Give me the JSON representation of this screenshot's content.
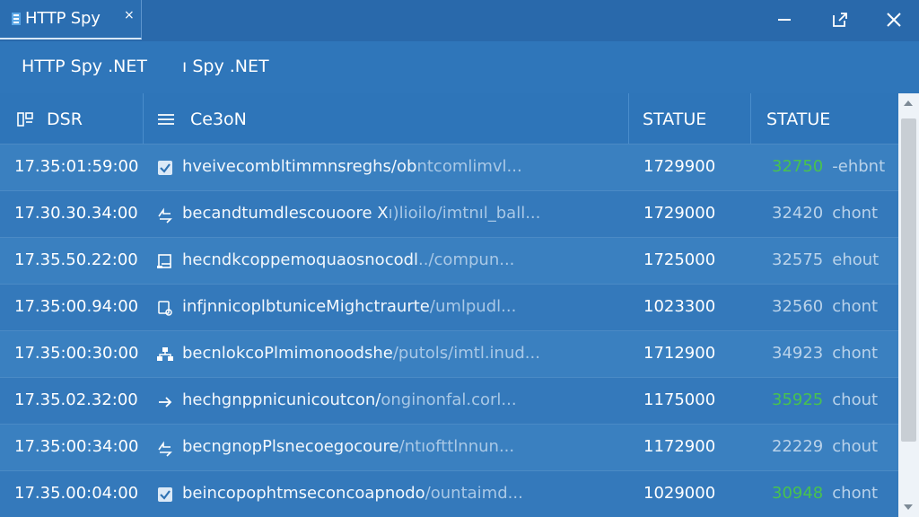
{
  "window": {
    "tab_title": "HTTP Spy",
    "tab_close": "×",
    "controls": [
      "minimize-icon",
      "popout-icon",
      "close-icon"
    ]
  },
  "header": {
    "title": "HTTP Spy .NET",
    "subtitle": "ı Spy .NET"
  },
  "table": {
    "columns": [
      "DSR",
      "Ce3oN",
      "STATUE",
      "STATUE"
    ],
    "rows": [
      {
        "time": "17.35:01:59:00",
        "icon": "checkbox-icon",
        "url": "hveivecombltimmnsreghs/ob",
        "url_faded": "ntcomlimvl...",
        "size": "1729900",
        "status": "32750",
        "status_style": "green",
        "label": "-ehbnt"
      },
      {
        "time": "17.30.30.34:00",
        "icon": "request-icon",
        "url": "becandtumdlescouoore X",
        "url_faded": "ı)lioilo/imtnıl_ball...",
        "size": "1729000",
        "status": "32420",
        "status_style": "gray",
        "label": "chont"
      },
      {
        "time": "17.35.50.22:00",
        "icon": "document-icon",
        "url": "hecndkcoppemoquaosnocodl",
        "url_faded": "../compun...",
        "size": "1725000",
        "status": "32575",
        "status_style": "gray",
        "label": "ehout"
      },
      {
        "time": "17.35:00.94:00",
        "icon": "attachment-icon",
        "url": "infjnnicoplbtuniceMighctraurte",
        "url_faded": "/umlpudl...",
        "size": "1023300",
        "status": "32560",
        "status_style": "gray",
        "label": "chont"
      },
      {
        "time": "17.35:00:30:00",
        "icon": "network-icon",
        "url": "becnlokcoPlmimonoodshe",
        "url_faded": "/putols/imtl.inud...",
        "size": "1712900",
        "status": "34923",
        "status_style": "gray",
        "label": "chont"
      },
      {
        "time": "17.35.02.32:00",
        "icon": "redirect-icon",
        "url": "hechgnppnicunicoutcon/",
        "url_faded": "onginonfal.corl...",
        "size": "1175000",
        "status": "35925",
        "status_style": "green",
        "label": "chout"
      },
      {
        "time": "17.35:00:34:00",
        "icon": "request-icon",
        "url": "becngnopPlsnecoegocoure",
        "url_faded": "/ntıofttlnnun...",
        "size": "1172900",
        "status": "22229",
        "status_style": "gray",
        "label": "chout"
      },
      {
        "time": "17.35.00:04:00",
        "icon": "checkbox-icon",
        "url": "beincopophtmseconcoapnodo",
        "url_faded": "/ountaimd...",
        "size": "1029000",
        "status": "30948",
        "status_style": "green",
        "label": "chont"
      }
    ]
  },
  "colors": {
    "background": "#2f73b4",
    "row_even": "#3a80c0",
    "row_odd": "#3479bb",
    "status_green": "#48c24f"
  }
}
